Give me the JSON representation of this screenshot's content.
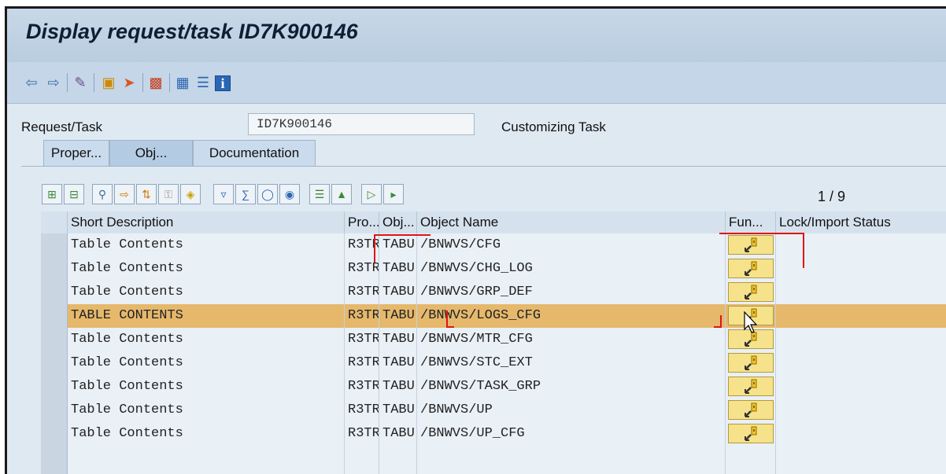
{
  "title": "Display request/task ID7K900146",
  "toolbar": {
    "icons": [
      "back-arrow-icon",
      "forward-arrow-icon",
      "glasses-pencil-icon",
      "object-list-icon",
      "release-icon",
      "truck-icon",
      "hierarchy-icon",
      "list-align-icon",
      "info-icon"
    ]
  },
  "header": {
    "request_label": "Request/Task",
    "request_value": "ID7K900146",
    "request_desc": "Customizing Task"
  },
  "tabs": [
    {
      "label": "Proper..."
    },
    {
      "label": "Obj..."
    },
    {
      "label": "Documentation"
    }
  ],
  "grid_toolbar": {
    "icons": [
      "insert-row-icon",
      "delete-row-icon",
      "detail-icon",
      "select-icon",
      "sort-icon",
      "lock-icon",
      "key-icon",
      "filter-icon",
      "total-icon",
      "find-icon",
      "find-next-icon",
      "expand-icon",
      "collapse-icon",
      "export-icon",
      "layout-icon"
    ],
    "pager": "1  /  9"
  },
  "columns": [
    "Short Description",
    "Pro...",
    "Obj...",
    "Object Name",
    "Fun...",
    "Lock/Import Status"
  ],
  "rows": [
    {
      "desc": "Table Contents",
      "pgmid": "R3TR",
      "obj": "TABU",
      "name": "/BNWVS/CFG"
    },
    {
      "desc": "Table Contents",
      "pgmid": "R3TR",
      "obj": "TABU",
      "name": "/BNWVS/CHG_LOG"
    },
    {
      "desc": "Table Contents",
      "pgmid": "R3TR",
      "obj": "TABU",
      "name": "/BNWVS/GRP_DEF"
    },
    {
      "desc": "TABLE CONTENTS",
      "pgmid": "R3TR",
      "obj": "TABU",
      "name": "/BNWVS/LOGS_CFG"
    },
    {
      "desc": "Table Contents",
      "pgmid": "R3TR",
      "obj": "TABU",
      "name": "/BNWVS/MTR_CFG"
    },
    {
      "desc": "Table Contents",
      "pgmid": "R3TR",
      "obj": "TABU",
      "name": "/BNWVS/STC_EXT"
    },
    {
      "desc": "Table Contents",
      "pgmid": "R3TR",
      "obj": "TABU",
      "name": "/BNWVS/TASK_GRP"
    },
    {
      "desc": "Table Contents",
      "pgmid": "R3TR",
      "obj": "TABU",
      "name": "/BNWVS/UP"
    },
    {
      "desc": "Table Contents",
      "pgmid": "R3TR",
      "obj": "TABU",
      "name": "/BNWVS/UP_CFG"
    }
  ],
  "selected_row": 3,
  "colors": {
    "selected_row": "#e5b86c",
    "title_bar": "#c7d8e8",
    "key_button": "#f6e28a",
    "annotation": "#e01515"
  }
}
